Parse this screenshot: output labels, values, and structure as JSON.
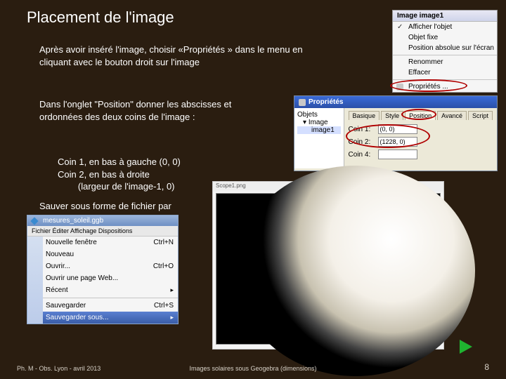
{
  "title": "Placement de l'image",
  "para1_a": "Après avoir inséré l'image, choisir «",
  "para1_key": "Propriétés",
  "para1_b": " » dans le menu en cliquant avec le bouton droit  sur l'image",
  "para2": "Dans l'onglet \"Position\" donner les abscisses et ordonnées des deux coins de l'image :",
  "para3_l1": "Coin 1, en bas à gauche (0, 0)",
  "para3_l2": "Coin 2, en bas à droite",
  "para3_l3": "(largeur de l'image-1, 0)",
  "para3_l3_indent": "        ",
  "para4": "Sauver sous forme de fichier par",
  "footer": {
    "left": "Ph. M  - Obs. Lyon - avril 2013",
    "mid": "Images solaires sous Geogebra (dimensions)",
    "page": "8"
  },
  "context_menu": {
    "title": "Image image1",
    "items": [
      "Afficher l'objet",
      "Objet fixe",
      "Position absolue sur l'écran",
      "Renommer",
      "Effacer",
      "Propriétés ..."
    ],
    "checked_index": 0,
    "circled_index": 5
  },
  "properties": {
    "title": "Propriétés",
    "tree": {
      "root": "Objets",
      "node": "Image",
      "leaf": "image1"
    },
    "tabs": [
      "Basique",
      "Style",
      "Position",
      "Avancé",
      "Script"
    ],
    "active_tab": 2,
    "fields": [
      {
        "label": "Coin 1:",
        "value": "(0, 0)"
      },
      {
        "label": "Coin 2:",
        "value": "(1228, 0)"
      },
      {
        "label": "Coin 4:",
        "value": ""
      }
    ]
  },
  "filemenu": {
    "title": "mesures_soleil.ggb",
    "menubar": "Fichier  Éditer  Affichage  Dispositions",
    "items": [
      {
        "label": "Nouvelle fenêtre",
        "accel": "Ctrl+N"
      },
      {
        "label": "Nouveau",
        "accel": ""
      },
      {
        "label": "Ouvrir...",
        "accel": "Ctrl+O"
      },
      {
        "label": "Ouvrir une page Web...",
        "accel": ""
      },
      {
        "label": "Récent",
        "accel": "",
        "arrow": true
      },
      {
        "label": "Sauvegarder",
        "accel": "Ctrl+S"
      }
    ],
    "highlighted": "Sauvegarder sous..."
  },
  "sun": {
    "header": "Scope1.png"
  },
  "icons": {
    "gear": "gear-icon",
    "rename": "A",
    "erase": "erase-icon",
    "file": "file-icon"
  }
}
